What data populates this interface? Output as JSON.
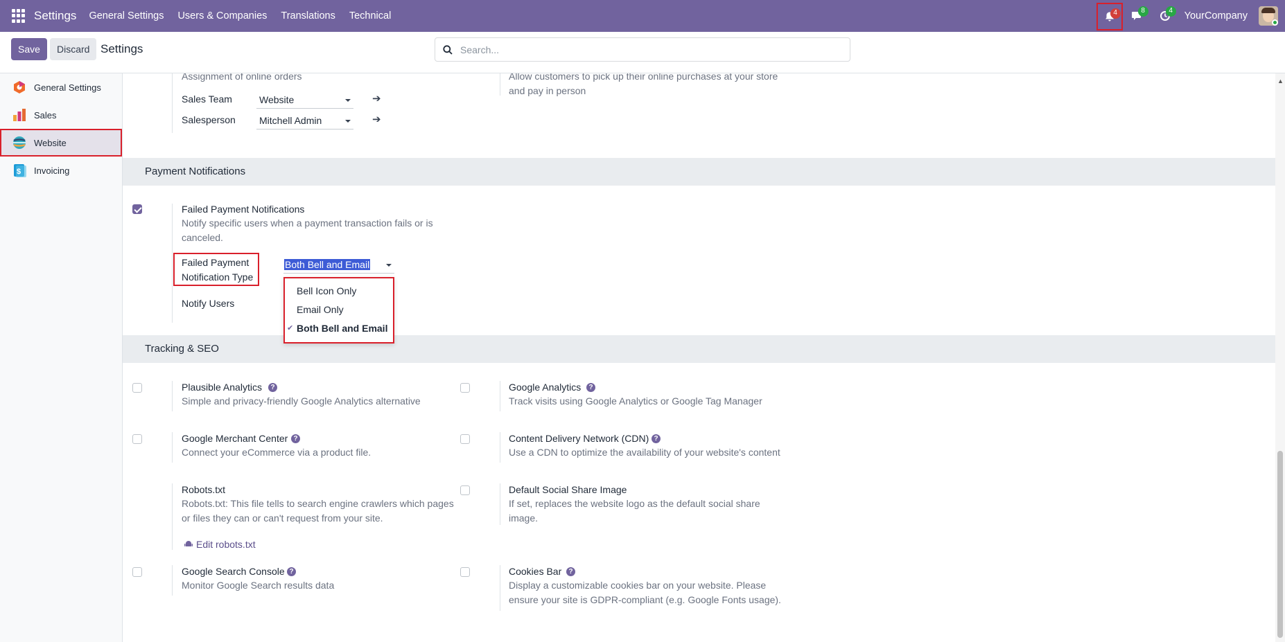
{
  "navbar": {
    "app_name": "Settings",
    "menu": [
      "General Settings",
      "Users & Companies",
      "Translations",
      "Technical"
    ],
    "activity_count": "4",
    "messages_count": "8",
    "activities_count": "4",
    "company": "YourCompany"
  },
  "control": {
    "save_label": "Save",
    "discard_label": "Discard",
    "title": "Settings",
    "search_placeholder": "Search..."
  },
  "sidebar": {
    "items": [
      {
        "label": "General Settings",
        "icon": "general-settings-icon"
      },
      {
        "label": "Sales",
        "icon": "sales-icon"
      },
      {
        "label": "Website",
        "icon": "website-icon",
        "active": true
      },
      {
        "label": "Invoicing",
        "icon": "invoicing-icon"
      }
    ]
  },
  "top_partial": {
    "left_desc": "Assignment of online orders",
    "right_desc_1": "Allow customers to pick up their online purchases at your store",
    "right_desc_2": "and pay in person",
    "sales_team_label": "Sales Team",
    "sales_team_value": "Website",
    "salesperson_label": "Salesperson",
    "salesperson_value": "Mitchell Admin"
  },
  "payment": {
    "section_title": "Payment Notifications",
    "title": "Failed Payment Notifications",
    "desc_1": "Notify specific users when a payment transaction fails or is",
    "desc_2": "canceled.",
    "checked": true,
    "type_label_1": "Failed Payment",
    "type_label_2": "Notification Type",
    "type_value": "Both Bell and Email",
    "notify_users_label": "Notify Users",
    "dropdown_options": [
      "Bell Icon Only",
      "Email Only",
      "Both Bell and Email"
    ],
    "dropdown_selected": "Both Bell and Email"
  },
  "tracking": {
    "section_title": "Tracking & SEO",
    "plausible_title": "Plausible Analytics",
    "plausible_desc": "Simple and privacy-friendly Google Analytics alternative",
    "ga_title": "Google Analytics",
    "ga_desc": "Track visits using Google Analytics or Google Tag Manager",
    "gmc_title": "Google Merchant Center",
    "gmc_desc": "Connect your eCommerce via a product file.",
    "cdn_title": "Content Delivery Network (CDN)",
    "cdn_desc": "Use a CDN to optimize the availability of your website's content",
    "robots_title": "Robots.txt",
    "robots_desc_1": "Robots.txt: This file tells to search engine crawlers which pages",
    "robots_desc_2": "or files they can or can't request from your site.",
    "robots_link": "Edit robots.txt",
    "social_title": "Default Social Share Image",
    "social_desc_1": "If set, replaces the website logo as the default social share",
    "social_desc_2": "image.",
    "gsc_title": "Google Search Console",
    "gsc_desc": "Monitor Google Search results data",
    "cookies_title": "Cookies Bar",
    "cookies_desc_1": "Display a customizable cookies bar on your website. Please",
    "cookies_desc_2": "ensure your site is GDPR-compliant (e.g. Google Fonts usage)."
  },
  "colors": {
    "brand": "#71639e",
    "highlight": "#d9202b"
  }
}
